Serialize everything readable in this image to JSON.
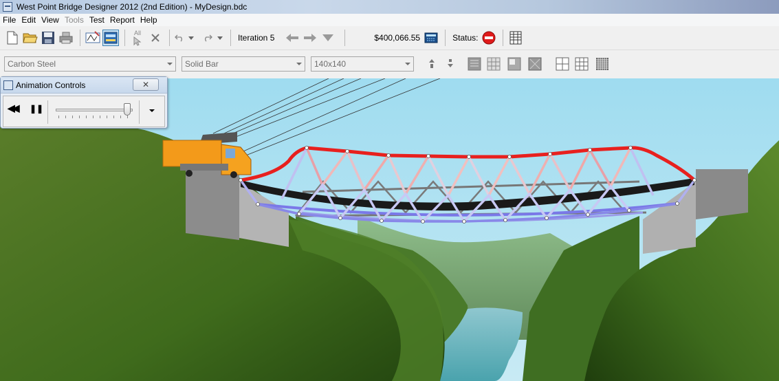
{
  "window": {
    "title": "West Point Bridge Designer 2012 (2nd Edition) - MyDesign.bdc"
  },
  "menu": {
    "items": [
      {
        "label": "File",
        "enabled": true
      },
      {
        "label": "Edit",
        "enabled": true
      },
      {
        "label": "View",
        "enabled": true
      },
      {
        "label": "Tools",
        "enabled": false
      },
      {
        "label": "Test",
        "enabled": true
      },
      {
        "label": "Report",
        "enabled": true
      },
      {
        "label": "Help",
        "enabled": true
      }
    ]
  },
  "toolbar": {
    "iteration_label": "Iteration 5",
    "cost": "$400,066.55",
    "status_label": "Status:",
    "select_all_label": "All"
  },
  "member_toolbar": {
    "material": "Carbon Steel",
    "cross_section": "Solid Bar",
    "size": "140x140"
  },
  "animation_controls": {
    "title": "Animation Controls",
    "close_glyph": "✕",
    "rewind_glyph": "◀◀",
    "pause_glyph": "❚❚",
    "speed_level": 0.95
  },
  "colors": {
    "compression": "#e8201e",
    "tension": "#5b5bea",
    "sky": "#a6dff0",
    "status_stop": "#e01b1b"
  }
}
